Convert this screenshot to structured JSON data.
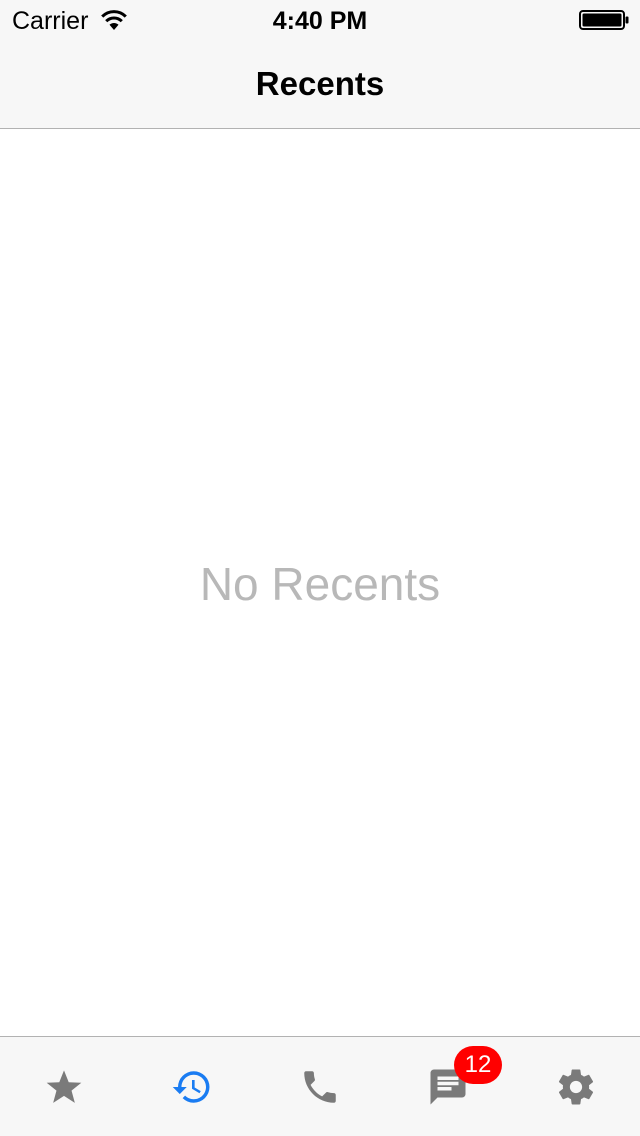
{
  "status_bar": {
    "carrier": "Carrier",
    "time": "4:40 PM"
  },
  "nav": {
    "title": "Recents"
  },
  "content": {
    "empty_message": "No Recents"
  },
  "tab_bar": {
    "tabs": [
      {
        "icon": "star-icon",
        "selected": false
      },
      {
        "icon": "history-icon",
        "selected": true
      },
      {
        "icon": "phone-icon",
        "selected": false
      },
      {
        "icon": "message-icon",
        "selected": false,
        "badge": "12"
      },
      {
        "icon": "gear-icon",
        "selected": false
      }
    ]
  },
  "colors": {
    "tab_active": "#1a7cf2",
    "tab_inactive": "#7a7a7a",
    "badge": "#ff0000",
    "placeholder_text": "#b8b8b8"
  }
}
